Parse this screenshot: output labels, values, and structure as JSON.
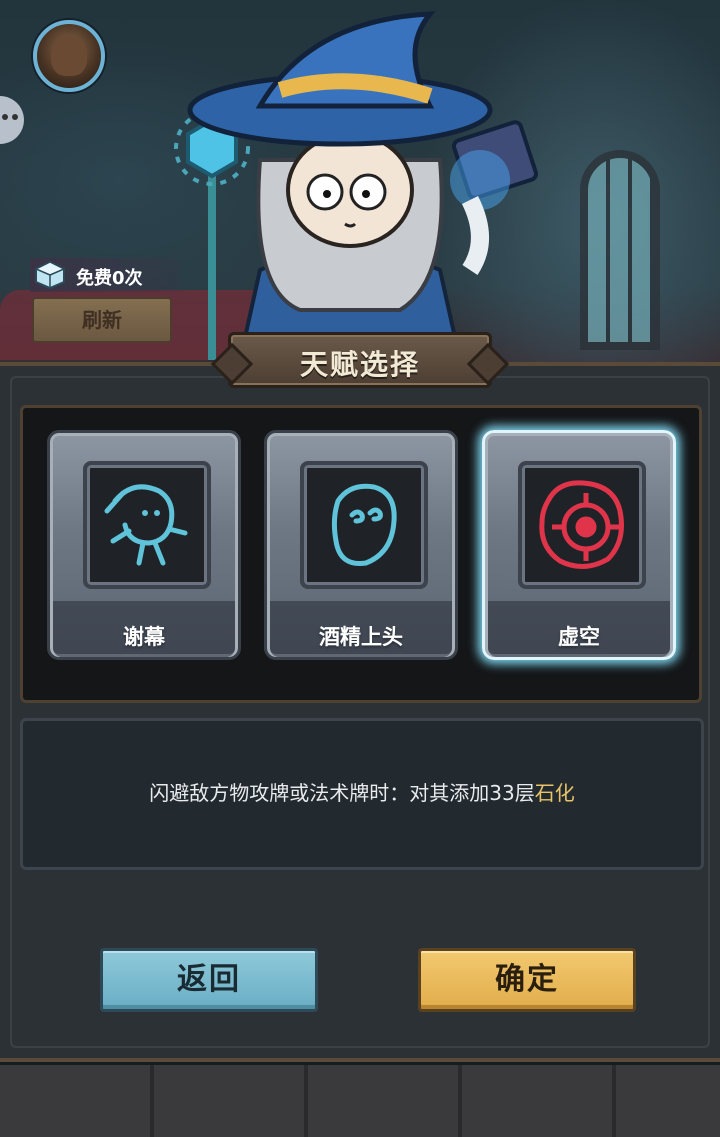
{
  "header": {
    "free_label": "免费0次",
    "refresh_label": "刷新"
  },
  "panel": {
    "title": "天赋选择"
  },
  "talents": [
    {
      "name": "谢幕",
      "icon": "hooded-figure-icon",
      "selected": false
    },
    {
      "name": "酒精上头",
      "icon": "dizzy-blob-icon",
      "selected": false
    },
    {
      "name": "虚空",
      "icon": "void-eye-icon",
      "selected": true
    }
  ],
  "description": {
    "prefix": "闪避敌方物攻牌或法术牌时：对其添加33层",
    "keyword": "石化"
  },
  "buttons": {
    "back": "返回",
    "confirm": "确定"
  },
  "colors": {
    "highlight": "#e8c36a",
    "selected_glow": "#7ed6f0",
    "back_button": "#8ec9da",
    "confirm_button": "#f2c96e"
  }
}
